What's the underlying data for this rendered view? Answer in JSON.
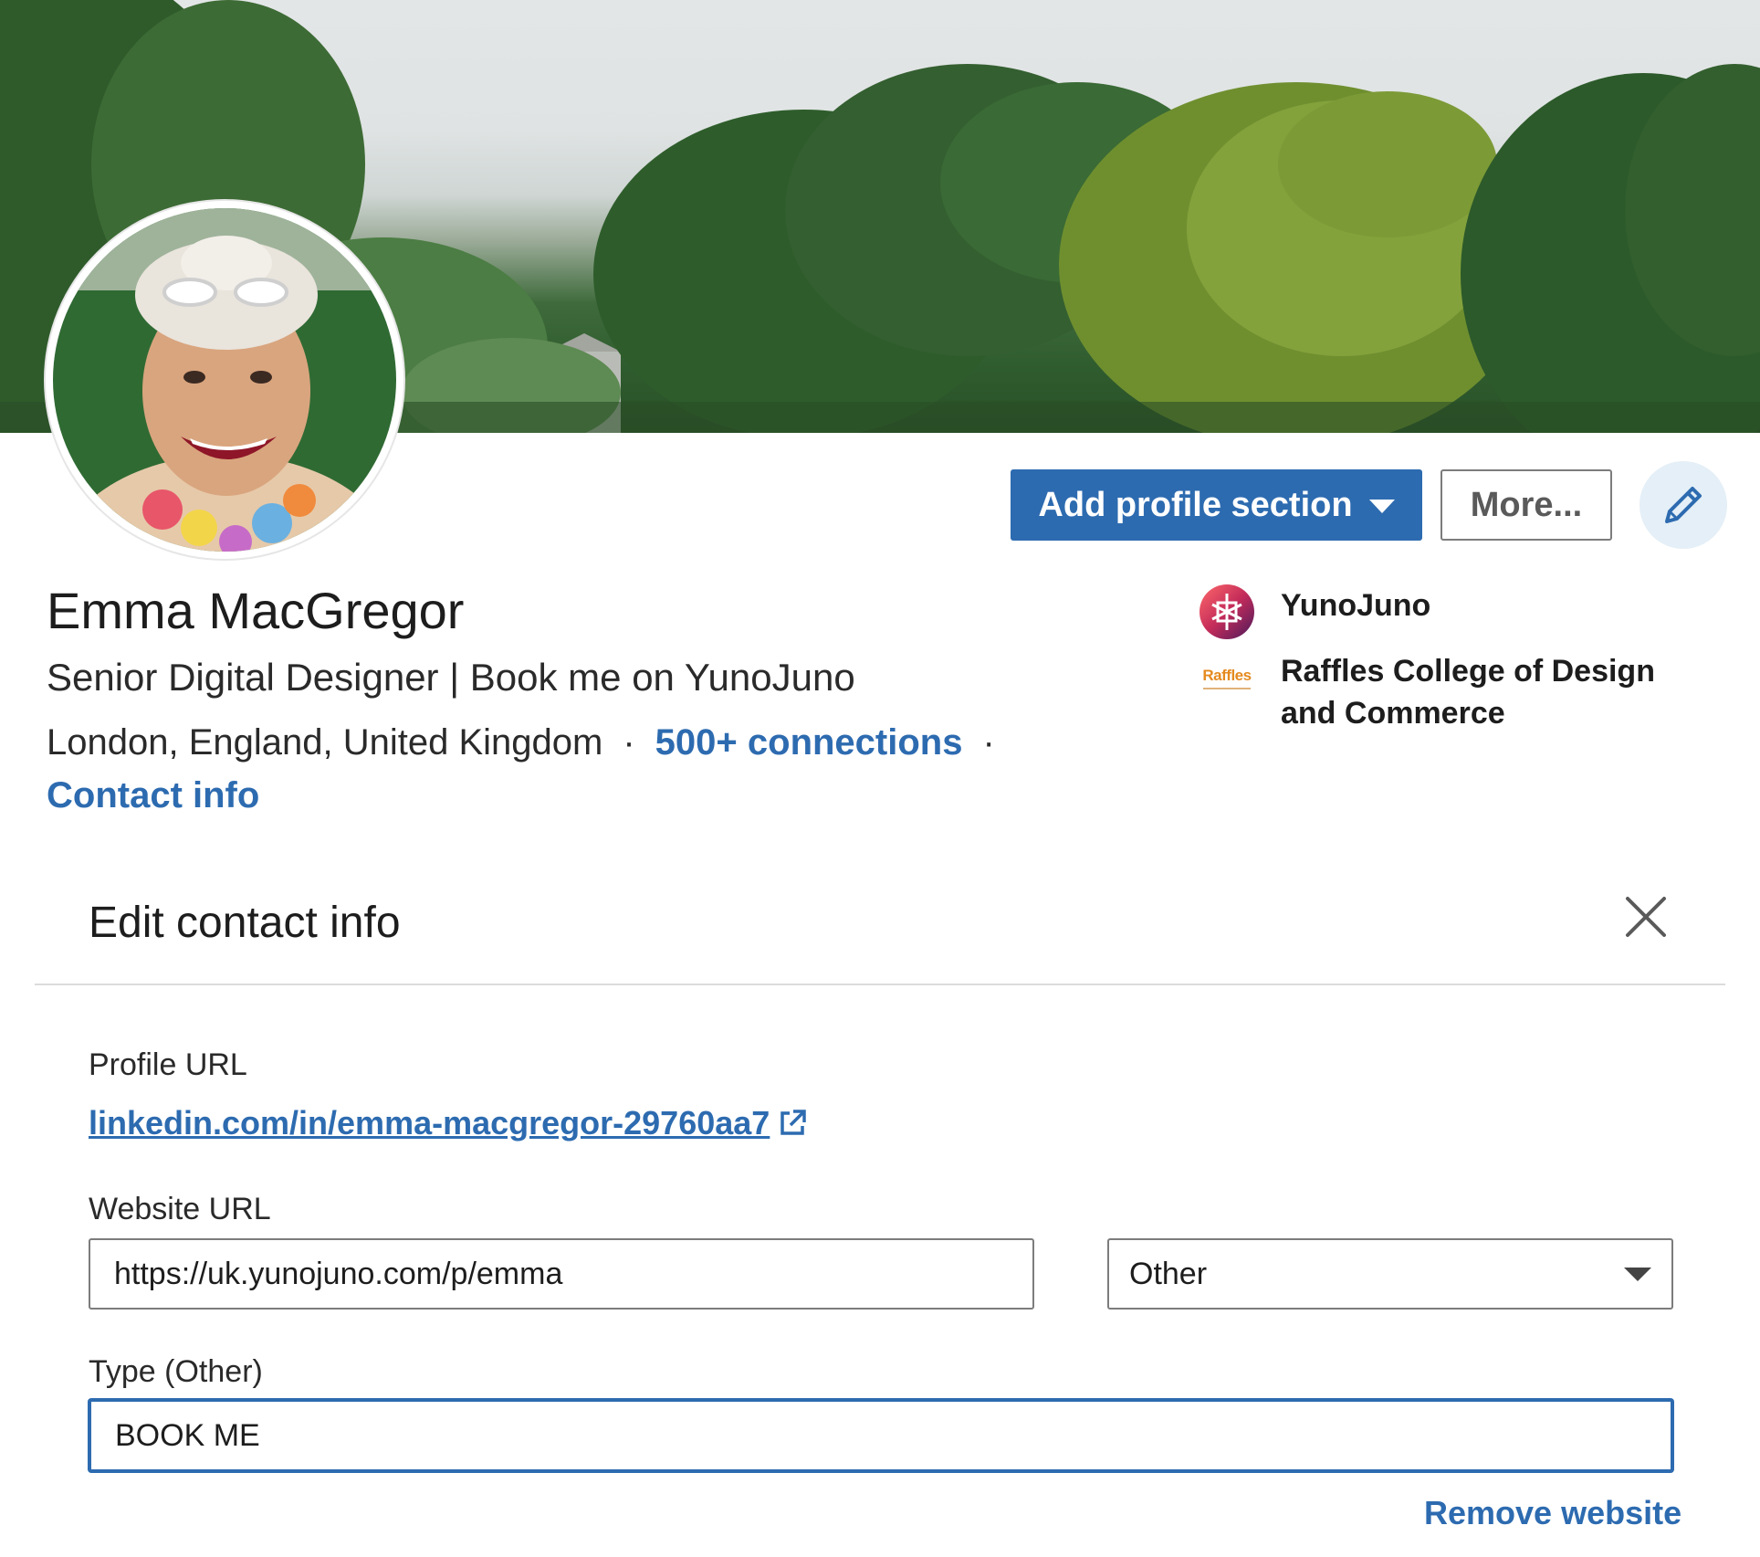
{
  "profile": {
    "name": "Emma MacGregor",
    "headline": "Senior Digital Designer | Book me on YunoJuno",
    "location": "London, England, United Kingdom",
    "separator": "·",
    "connections": "500+ connections",
    "contact_info": "Contact info"
  },
  "actions": {
    "add_section": "Add profile section",
    "more": "More...",
    "edit_icon": "pencil-icon"
  },
  "organizations": [
    {
      "name": "YunoJuno",
      "logo_icon": "yunojuno-logo"
    },
    {
      "name": "Raffles College of Design and Commerce",
      "logo_icon": "raffles-logo",
      "logo_text": "Raffles"
    }
  ],
  "modal": {
    "title": "Edit contact info",
    "close_icon": "close-icon",
    "profile_url_label": "Profile URL",
    "profile_url": "linkedin.com/in/emma-macgregor-29760aa7",
    "website_url_label": "Website URL",
    "website_url_value": "https://uk.yunojuno.com/p/emma",
    "website_type_selected": "Other",
    "type_other_label": "Type (Other)",
    "type_other_value": "BOOK ME",
    "remove_website": "Remove website"
  },
  "colors": {
    "primary": "#2d6bb0",
    "edit_bg": "#e4eff7",
    "border": "#7c7c7c",
    "divider": "#dcdcdc"
  }
}
